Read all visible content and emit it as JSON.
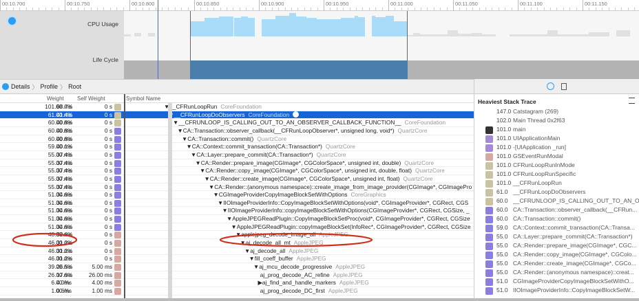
{
  "ruler": {
    "ticks": [
      "00:10.700",
      "00:10.750",
      "00:10.800",
      "00:10.850",
      "00:10.900",
      "00:10.950",
      "00:11.000",
      "00:11.050",
      "00:11.100",
      "00:11.150"
    ]
  },
  "tracks": {
    "cpu_label": "CPU Usage",
    "lifecycle_label": "Life Cycle"
  },
  "breadcrumb": [
    "Details",
    "Profile",
    "Root"
  ],
  "table": {
    "headers": {
      "weight": "Weight",
      "self": "Self Weight",
      "symbol": "Symbol Name"
    },
    "rows": [
      {
        "w": "101.00 ms",
        "p": "68.7%",
        "s": "0 s",
        "ic": "cf",
        "d": 0,
        "sym": "▼__CFRunLoopRun",
        "lib": "CoreFoundation"
      },
      {
        "w": "61.00 ms",
        "p": "41.4%",
        "s": "0 s",
        "ic": "cf",
        "d": 1,
        "sym": "▼__CFRunLoopDoObservers",
        "lib": "CoreFoundation",
        "sel": true
      },
      {
        "w": "60.00 ms",
        "p": "40.8%",
        "s": "0 s",
        "ic": "cf",
        "d": 2,
        "sym": "▼__CFRUNLOOP_IS_CALLING_OUT_TO_AN_OBSERVER_CALLBACK_FUNCTION__",
        "lib": "CoreFoundation"
      },
      {
        "w": "60.00 ms",
        "p": "40.8%",
        "s": "0 s",
        "ic": "qc",
        "d": 3,
        "sym": "▼CA::Transaction::observer_callback(__CFRunLoopObserver*, unsigned long, void*)",
        "lib": "QuartzCore"
      },
      {
        "w": "60.00 ms",
        "p": "40.8%",
        "s": "0 s",
        "ic": "qc",
        "d": 4,
        "sym": "▼CA::Transaction::commit()",
        "lib": "QuartzCore"
      },
      {
        "w": "59.00 ms",
        "p": "40.1%",
        "s": "0 s",
        "ic": "qc",
        "d": 5,
        "sym": "▼CA::Context::commit_transaction(CA::Transaction*)",
        "lib": "QuartzCore"
      },
      {
        "w": "55.00 ms",
        "p": "37.4%",
        "s": "0 s",
        "ic": "qc",
        "d": 6,
        "sym": "▼CA::Layer::prepare_commit(CA::Transaction*)",
        "lib": "QuartzCore"
      },
      {
        "w": "55.00 ms",
        "p": "37.4%",
        "s": "0 s",
        "ic": "qc",
        "d": 7,
        "sym": "▼CA::Render::prepare_image(CGImage*, CGColorSpace*, unsigned int, double)",
        "lib": "QuartzCore"
      },
      {
        "w": "55.00 ms",
        "p": "37.4%",
        "s": "0 s",
        "ic": "qc",
        "d": 8,
        "sym": "▼CA::Render::copy_image(CGImage*, CGColorSpace*, unsigned int, double, float)",
        "lib": "QuartzCore"
      },
      {
        "w": "55.00 ms",
        "p": "37.4%",
        "s": "0 s",
        "ic": "qc",
        "d": 9,
        "sym": "▼CA::Render::create_image(CGImage*, CGColorSpace*, unsigned int, float)",
        "lib": "QuartzCore"
      },
      {
        "w": "55.00 ms",
        "p": "37.4%",
        "s": "0 s",
        "ic": "qc",
        "d": 10,
        "sym": "▼CA::Render::(anonymous namespace)::create_image_from_image_provider(CGImage*, CGImagePro",
        "lib": ""
      },
      {
        "w": "51.00 ms",
        "p": "34.6%",
        "s": "0 s",
        "ic": "qc",
        "d": 11,
        "sym": "▼CGImageProviderCopyImageBlockSetWithOptions",
        "lib": "CoreGraphics"
      },
      {
        "w": "51.00 ms",
        "p": "34.6%",
        "s": "0 s",
        "ic": "qc",
        "d": 12,
        "sym": "▼IIOImageProviderInfo::CopyImageBlockSetWithOptions(void*, CGImageProvider*, CGRect, CGS",
        "lib": ""
      },
      {
        "w": "51.00 ms",
        "p": "34.6%",
        "s": "0 s",
        "ic": "qc",
        "d": 13,
        "sym": "▼IIOImageProviderInfo::copyImageBlockSetWithOptions(CGImageProvider*, CGRect, CGSize, _",
        "lib": ""
      },
      {
        "w": "51.00 ms",
        "p": "34.6%",
        "s": "0 s",
        "ic": "qc",
        "d": 14,
        "sym": "▼AppleJPEGReadPlugin::CopyImageBlockSetProc(void*, CGImageProvider*, CGRect, CGSize",
        "lib": ""
      },
      {
        "w": "51.00 ms",
        "p": "34.6%",
        "s": "0 s",
        "ic": "qc",
        "d": 15,
        "sym": "▼AppleJPEGReadPlugin::copyImageBlockSet(InfoRec*, CGImageProvider*, CGRect, CGSize",
        "lib": ""
      },
      {
        "w": "48.00 ms",
        "p": "32.6%",
        "s": "0 s",
        "ic": "aj",
        "d": 16,
        "sym": "▼applejpeg_decode_image_all",
        "lib": "AppleJPEG"
      },
      {
        "w": "46.00 ms",
        "p": "31.2%",
        "s": "0 s",
        "ic": "aj",
        "d": 17,
        "sym": "▼aj_decode_all_mt",
        "lib": "AppleJPEG"
      },
      {
        "w": "46.00 ms",
        "p": "31.2%",
        "s": "0 s",
        "ic": "aj",
        "d": 18,
        "sym": "▼aj_decode_all",
        "lib": "AppleJPEG"
      },
      {
        "w": "46.00 ms",
        "p": "31.2%",
        "s": "0 s",
        "ic": "aj",
        "d": 19,
        "sym": "▼fill_coeff_buffer",
        "lib": "AppleJPEG"
      },
      {
        "w": "39.00 ms",
        "p": "26.5%",
        "s": "5.00 ms",
        "ic": "aj",
        "d": 20,
        "sym": "▼aj_mcu_decode_progressive",
        "lib": "AppleJPEG"
      },
      {
        "w": "26.00 ms",
        "p": "17.6%",
        "s": "26.00 ms",
        "ic": "aj",
        "d": 21.5,
        "sym": "aj_prog_decode_AC_refine",
        "lib": "AppleJPEG"
      },
      {
        "w": "6.00 ms",
        "p": "4.0%",
        "s": "4.00 ms",
        "ic": "aj",
        "d": 21,
        "sym": "▶aj_find_and_handle_markers",
        "lib": "AppleJPEG"
      },
      {
        "w": "1.00 ms",
        "p": "0.6%",
        "s": "1.00 ms",
        "ic": "aj",
        "d": 21.5,
        "sym": "aj_prog_decode_DC_first",
        "lib": "AppleJPEG"
      }
    ]
  },
  "heaviest": {
    "title": "Heaviest Stack Trace",
    "items": [
      {
        "n": "147.0",
        "t": "Catstagram (269)",
        "ic": ""
      },
      {
        "n": "102.0",
        "t": "Main Thread  0x2f63",
        "ic": ""
      },
      {
        "n": "101.0",
        "t": "main",
        "ic": "usr"
      },
      {
        "n": "101.0",
        "t": "UIApplicationMain",
        "ic": "uk"
      },
      {
        "n": "101.0",
        "t": "-[UIApplication _run]",
        "ic": "uk"
      },
      {
        "n": "101.0",
        "t": "GSEventRunModal",
        "ic": "aj"
      },
      {
        "n": "101.0",
        "t": "CFRunLoopRunInMode",
        "ic": "cf"
      },
      {
        "n": "101.0",
        "t": "CFRunLoopRunSpecific",
        "ic": "cf"
      },
      {
        "n": "101.0",
        "t": "__CFRunLoopRun",
        "ic": "cf"
      },
      {
        "n": "61.0",
        "t": "__CFRunLoopDoObservers",
        "ic": "cf"
      },
      {
        "n": "60.0",
        "t": "__CFRUNLOOP_IS_CALLING_OUT_TO_AN_O...",
        "ic": "cf"
      },
      {
        "n": "60.0",
        "t": "CA::Transaction::observer_callback(__CFRun...",
        "ic": "qc"
      },
      {
        "n": "60.0",
        "t": "CA::Transaction::commit()",
        "ic": "qc"
      },
      {
        "n": "59.0",
        "t": "CA::Context::commit_transaction(CA::Transa...",
        "ic": "qc"
      },
      {
        "n": "55.0",
        "t": "CA::Layer::prepare_commit(CA::Transaction*)",
        "ic": "qc"
      },
      {
        "n": "55.0",
        "t": "CA::Render::prepare_image(CGImage*, CGC...",
        "ic": "qc"
      },
      {
        "n": "55.0",
        "t": "CA::Render::copy_image(CGImage*, CGColo...",
        "ic": "qc"
      },
      {
        "n": "55.0",
        "t": "CA::Render::create_image(CGImage*, CGCo...",
        "ic": "qc"
      },
      {
        "n": "55.0",
        "t": "CA::Render::(anonymous namespace)::creat...",
        "ic": "qc"
      },
      {
        "n": "51.0",
        "t": "CGImageProviderCopyImageBlockSetWithO...",
        "ic": "qc"
      },
      {
        "n": "51.0",
        "t": "IIOImageProviderInfo::CopyImageBlockSetW...",
        "ic": "qc"
      }
    ]
  },
  "colors": {
    "selection": "#1565d8",
    "cpu": "#a8dcf8",
    "lifecycle": "#4a7eab",
    "annotation": "#d0301c"
  }
}
